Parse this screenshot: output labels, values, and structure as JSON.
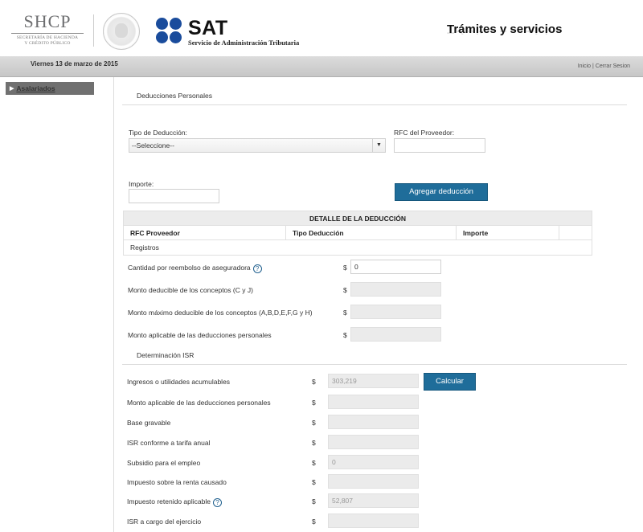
{
  "header": {
    "shcp_title": "SHCP",
    "shcp_sub1": "SECRETARÍA DE HACIENDA",
    "shcp_sub2": "Y CRÉDITO PÚBLICO",
    "sat_name": "SAT",
    "sat_sub": "Servicio de Administración Tributaria",
    "section_title": "Trámites y servicios",
    "brand_color": "#1a4c9c"
  },
  "topbar": {
    "date": "Viernes 13 de marzo de 2015",
    "link_inicio": "Inicio",
    "separator": "|",
    "link_cerrar": "Cerrar Sesion"
  },
  "sidebar": {
    "items": [
      {
        "label": "Asalariados"
      }
    ]
  },
  "deducciones": {
    "heading": "Deducciones Personales",
    "tipo_label": "Tipo de Deducción:",
    "tipo_value": "--Seleccione--",
    "rfc_label": "RFC del Proveedor:",
    "rfc_value": "",
    "importe_label": "Importe:",
    "importe_value": "",
    "add_button": "Agregar deducción",
    "button_color": "#1f6d9a"
  },
  "detalle": {
    "title": "DETALLE DE LA DEDUCCIÓN",
    "columns": [
      "RFC Proveedor",
      "Tipo Deducción",
      "Importe"
    ],
    "registros_label": "Registros"
  },
  "montos": [
    {
      "label": "Cantidad por reembolso de aseguradora",
      "currency": "$",
      "value": "0",
      "help": true,
      "enabled": true
    },
    {
      "label": "Monto deducible de los conceptos (C y J)",
      "currency": "$",
      "value": "",
      "help": false,
      "enabled": false
    },
    {
      "label": "Monto máximo deducible de los conceptos (A,B,D,E,F,G y H)",
      "currency": "$",
      "value": "",
      "help": false,
      "enabled": false
    },
    {
      "label": "Monto aplicable de las deducciones personales",
      "currency": "$",
      "value": "",
      "help": false,
      "enabled": false
    }
  ],
  "isr": {
    "heading": "Determinación ISR",
    "calc_button": "Calcular",
    "help_glyph": "?",
    "rows": [
      {
        "label": "Ingresos o utilidades acumulables",
        "currency": "$",
        "value": "303,219",
        "help": false
      },
      {
        "label": "Monto aplicable de las deducciones personales",
        "currency": "$",
        "value": "",
        "help": false
      },
      {
        "label": "Base gravable",
        "currency": "$",
        "value": "",
        "help": false
      },
      {
        "label": "ISR conforme a tarifa anual",
        "currency": "$",
        "value": "",
        "help": false
      },
      {
        "label": "Subsidio para el empleo",
        "currency": "$",
        "value": "0",
        "help": false
      },
      {
        "label": "Impuesto sobre la renta causado",
        "currency": "$",
        "value": "",
        "help": false
      },
      {
        "label": "Impuesto retenido aplicable",
        "currency": "$",
        "value": "52,807",
        "help": true
      },
      {
        "label": "ISR a cargo del ejercicio",
        "currency": "$",
        "value": "",
        "help": false
      }
    ]
  }
}
